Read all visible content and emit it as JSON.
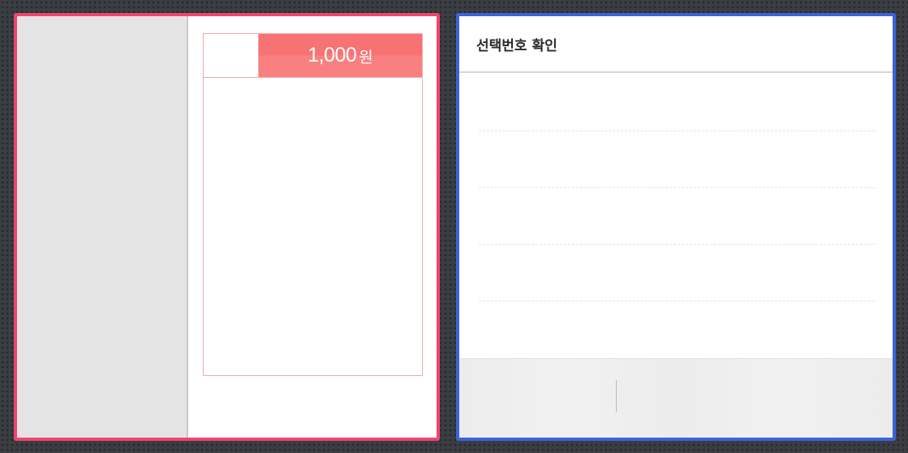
{
  "slip": {
    "price_amount": "1,000",
    "price_unit": "원",
    "accent_color": "#f0456f",
    "tag_color": "#f77272"
  },
  "confirm": {
    "title": "선택번호 확인",
    "accent_color": "#3c63d8",
    "rows": [
      "",
      "",
      "",
      "",
      ""
    ]
  }
}
